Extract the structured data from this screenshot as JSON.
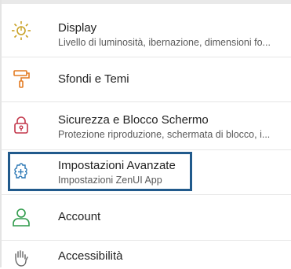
{
  "settings": {
    "items": [
      {
        "title": "Display",
        "subtitle": "Livello di luminosità, ibernazione, dimensioni fo...",
        "icon": "display-brightness-icon"
      },
      {
        "title": "Sfondi e Temi",
        "subtitle": "",
        "icon": "paint-roller-icon"
      },
      {
        "title": "Sicurezza e Blocco Schermo",
        "subtitle": "Protezione riproduzione, schermata di blocco, i...",
        "icon": "padlock-icon"
      },
      {
        "title": "Impostazioni Avanzate",
        "subtitle": "Impostazioni ZenUI App",
        "icon": "puzzle-plus-icon"
      },
      {
        "title": "Account",
        "subtitle": "",
        "icon": "person-icon"
      },
      {
        "title": "Accessibilità",
        "subtitle": "",
        "icon": "hand-icon"
      }
    ]
  },
  "colors": {
    "display_icon": "#c9a227",
    "wallpaper_icon": "#e37b22",
    "security_icon": "#c2364a",
    "advanced_icon": "#2c78b5",
    "account_icon": "#2e9a4a",
    "accessibility_icon": "#666666",
    "highlight_border": "#215a8c"
  }
}
